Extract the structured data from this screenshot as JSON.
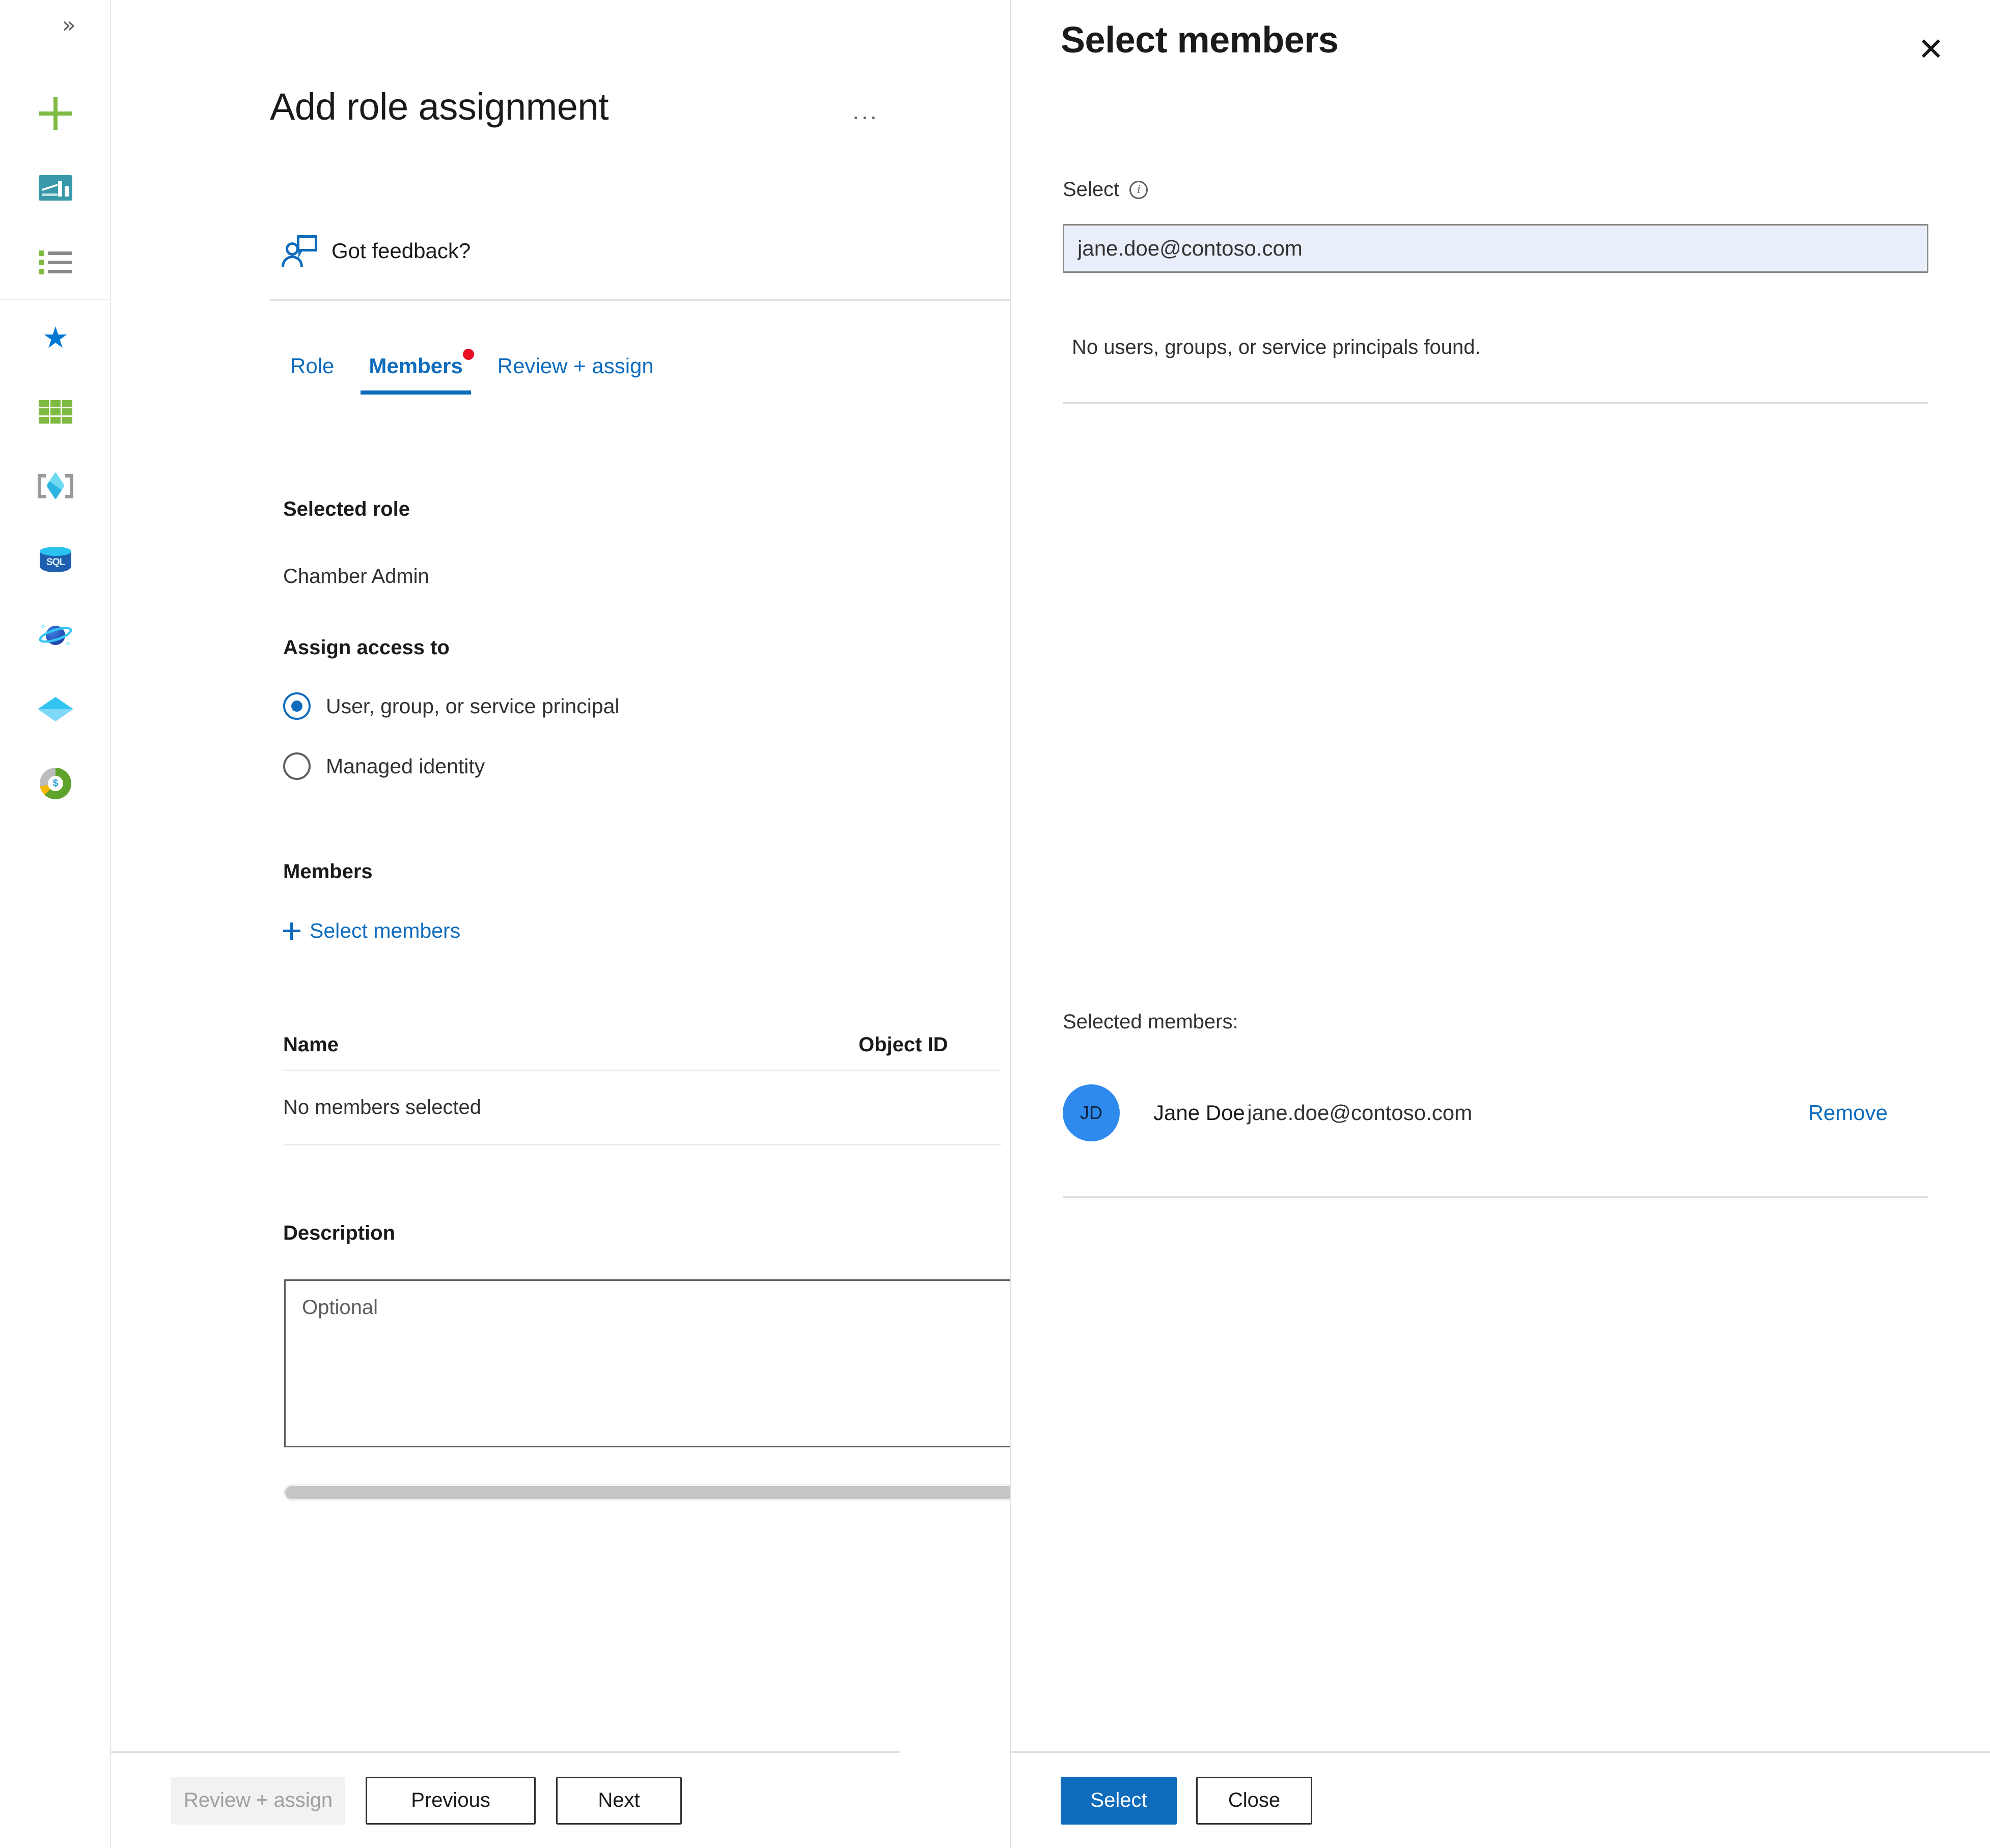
{
  "rail": {
    "expand_label": "»",
    "items": [
      {
        "name": "create-resource",
        "icon": "plus-icon",
        "label": "Create a resource"
      },
      {
        "name": "dashboard",
        "icon": "dashboard-icon",
        "label": "Dashboard"
      },
      {
        "name": "all-services",
        "icon": "list-icon",
        "label": "All services"
      },
      {
        "name": "favorites",
        "icon": "star-icon",
        "label": "Favorites"
      },
      {
        "name": "all-resources",
        "icon": "grid-icon",
        "label": "All resources"
      },
      {
        "name": "resource-groups",
        "icon": "resource-group-icon",
        "label": "Resource groups"
      },
      {
        "name": "sql-databases",
        "icon": "sql-database-icon",
        "label": "SQL databases"
      },
      {
        "name": "cosmos-db",
        "icon": "cosmos-db-icon",
        "label": "Azure Cosmos DB"
      },
      {
        "name": "virtual-machines",
        "icon": "diamond-icon",
        "label": "Virtual machines"
      },
      {
        "name": "cost-management",
        "icon": "cost-management-icon",
        "label": "Cost Management"
      }
    ]
  },
  "blade": {
    "title": "Add role assignment",
    "ellipsis": "···",
    "feedback_label": "Got feedback?",
    "tabs": [
      {
        "label": "Role",
        "active": false,
        "dot": false
      },
      {
        "label": "Members",
        "active": true,
        "dot": true
      },
      {
        "label": "Review + assign",
        "active": false,
        "dot": false
      }
    ],
    "selected_role_label": "Selected role",
    "selected_role_value": "Chamber Admin",
    "assign_access_label": "Assign access to",
    "assign_options": [
      {
        "label": "User, group, or service principal",
        "selected": true
      },
      {
        "label": "Managed identity",
        "selected": false
      }
    ],
    "members_label": "Members",
    "select_members_link": "Select members",
    "table": {
      "columns": [
        "Name",
        "Object ID"
      ],
      "rows": [
        {
          "name": "No members selected",
          "object_id": ""
        }
      ]
    },
    "description_label": "Description",
    "description_placeholder": "Optional",
    "description_value": "",
    "footer": {
      "review_assign": "Review + assign",
      "previous": "Previous",
      "next": "Next"
    }
  },
  "panel": {
    "title": "Select members",
    "close_label": "✕",
    "select_field_label": "Select",
    "search_value": "jane.doe@contoso.com",
    "search_placeholder": "",
    "no_results": "No users, groups, or service principals found.",
    "selected_members_label": "Selected members:",
    "selected_members": [
      {
        "initials": "JD",
        "name": "Jane Doe",
        "email": "jane.doe@contoso.com",
        "remove_label": "Remove"
      }
    ],
    "footer": {
      "select": "Select",
      "close": "Close"
    }
  },
  "colors": {
    "accent": "#0f6cbd",
    "primary_button": "#0f6cbd",
    "notification_dot": "#e81123",
    "avatar": "#2f8aee",
    "input_background": "#e9eefb",
    "plus_green": "#7fba42"
  }
}
